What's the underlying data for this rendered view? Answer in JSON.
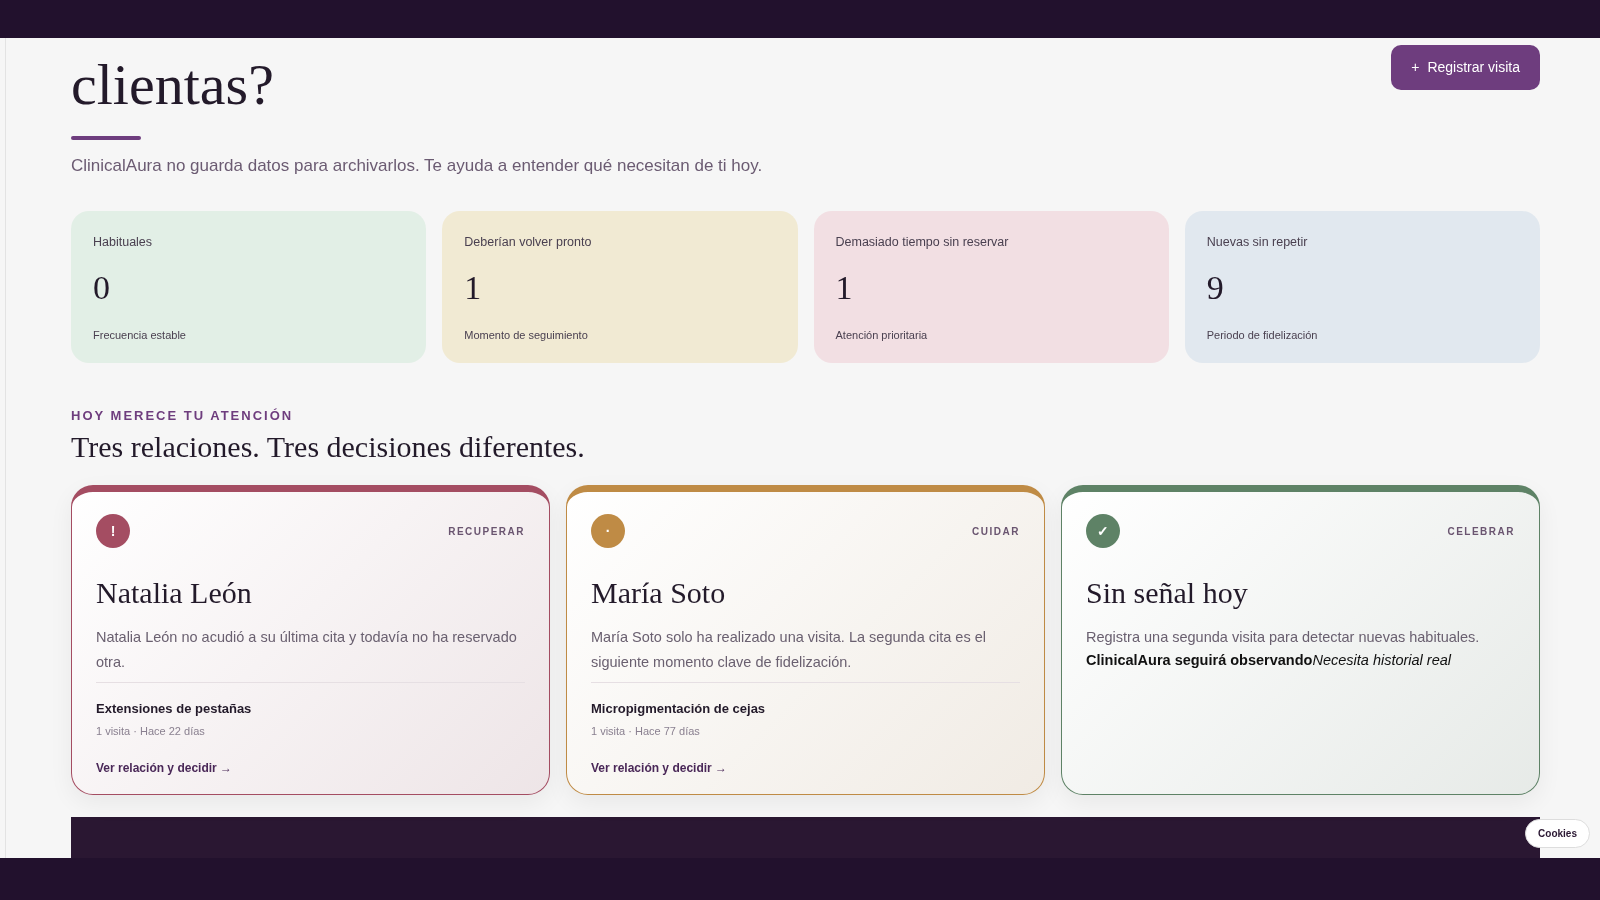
{
  "header": {
    "title": "clientas?",
    "subtitle": "ClinicalAura no guarda datos para archivarlos. Te ayuda a entender qué necesitan de ti hoy.",
    "action": {
      "icon": "+",
      "label": "Registrar visita"
    }
  },
  "stats": [
    {
      "label": "Habituales",
      "value": "0",
      "caption": "Frecuencia estable",
      "color": "#e2efe6"
    },
    {
      "label": "Deberían volver pronto",
      "value": "1",
      "caption": "Momento de seguimiento",
      "color": "#f1ead3"
    },
    {
      "label": "Demasiado tiempo sin reservar",
      "value": "1",
      "caption": "Atención prioritaria",
      "color": "#f2dfe3"
    },
    {
      "label": "Nuevas sin repetir",
      "value": "9",
      "caption": "Periodo de fidelización",
      "color": "#e1e8ef"
    }
  ],
  "section": {
    "eyebrow": "HOY MERECE TU ATENCIÓN",
    "title": "Tres relaciones. Tres decisiones diferentes."
  },
  "cards": [
    {
      "kind": "client",
      "color": "#a44d62",
      "symbol": "!",
      "tag": "RECUPERAR",
      "name": "Natalia León",
      "text": "Natalia León no acudió a su última cita y todavía no ha reservado otra.",
      "service": "Extensiones de pestañas",
      "meta": "1 visita · Hace 22 días",
      "link": "Ver relación y decidir →"
    },
    {
      "kind": "client",
      "color": "#bf8b45",
      "symbol": "·",
      "tag": "CUIDAR",
      "name": "María Soto",
      "text": "María Soto solo ha realizado una visita. La segunda cita es el siguiente momento clave de fidelización.",
      "service": "Micropigmentación de cejas",
      "meta": "1 visita · Hace 77 días",
      "link": "Ver relación y decidir →"
    },
    {
      "kind": "empty",
      "color": "#5e8266",
      "symbol": "✓",
      "tag": "CELEBRAR",
      "name": "Sin señal hoy",
      "text": "Registra una segunda visita para detectar nuevas habituales.",
      "status": "ClinicalAura seguirá observando",
      "hint": "Necesita historial real"
    }
  ],
  "cookies": {
    "label": "Cookies"
  }
}
